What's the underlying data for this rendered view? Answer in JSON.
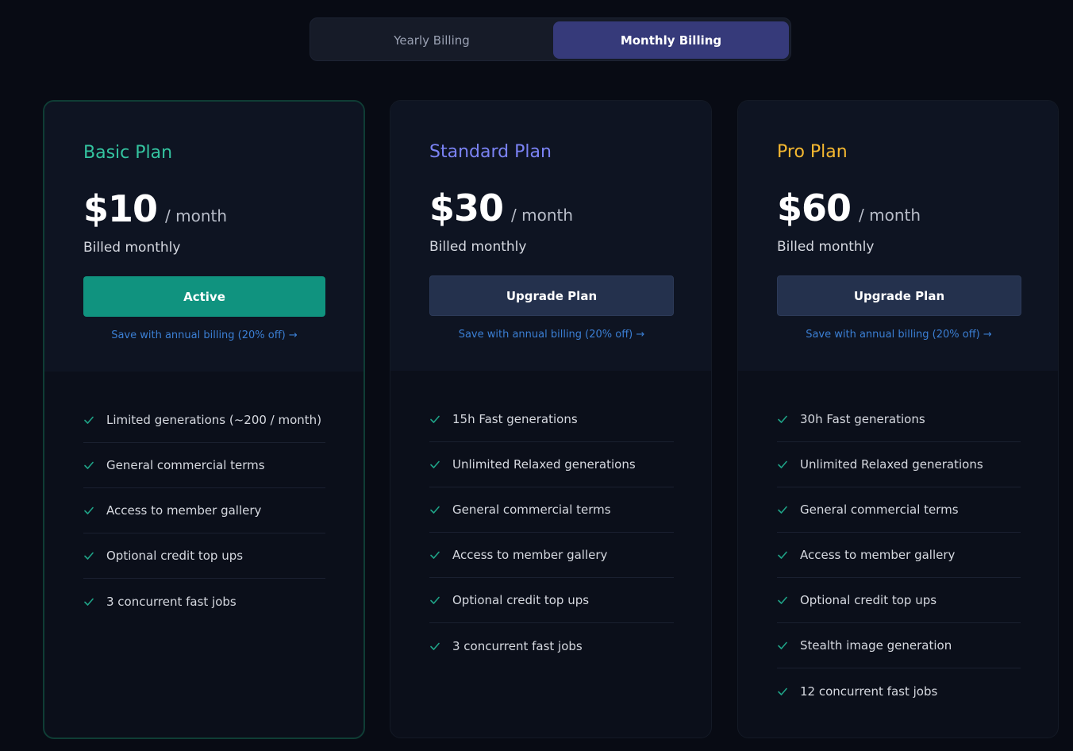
{
  "billing_toggle": {
    "yearly_label": "Yearly Billing",
    "monthly_label": "Monthly Billing",
    "selected": "Monthly Billing"
  },
  "colors": {
    "basic": "#34c4a0",
    "standard": "#7b83f5",
    "pro": "#f5b830",
    "check": "#1fa387",
    "active_button": "#10937f",
    "toggle_active": "#363a7a",
    "link": "#3b7fd4"
  },
  "plans": [
    {
      "name": "Basic Plan",
      "price": "$10",
      "period": "/ month",
      "billed": "Billed monthly",
      "button_label": "Active",
      "save_link": "Save with annual billing (20% off) →",
      "features": [
        "Limited generations (~200 / month)",
        "General commercial terms",
        "Access to member gallery",
        "Optional credit top ups",
        "3 concurrent fast jobs"
      ]
    },
    {
      "name": "Standard Plan",
      "price": "$30",
      "period": "/ month",
      "billed": "Billed monthly",
      "button_label": "Upgrade Plan",
      "save_link": "Save with annual billing (20% off) →",
      "features": [
        "15h Fast generations",
        "Unlimited Relaxed generations",
        "General commercial terms",
        "Access to member gallery",
        "Optional credit top ups",
        "3 concurrent fast jobs"
      ]
    },
    {
      "name": "Pro Plan",
      "price": "$60",
      "period": "/ month",
      "billed": "Billed monthly",
      "button_label": "Upgrade Plan",
      "save_link": "Save with annual billing (20% off) →",
      "features": [
        "30h Fast generations",
        "Unlimited Relaxed generations",
        "General commercial terms",
        "Access to member gallery",
        "Optional credit top ups",
        "Stealth image generation",
        "12 concurrent fast jobs"
      ]
    }
  ]
}
